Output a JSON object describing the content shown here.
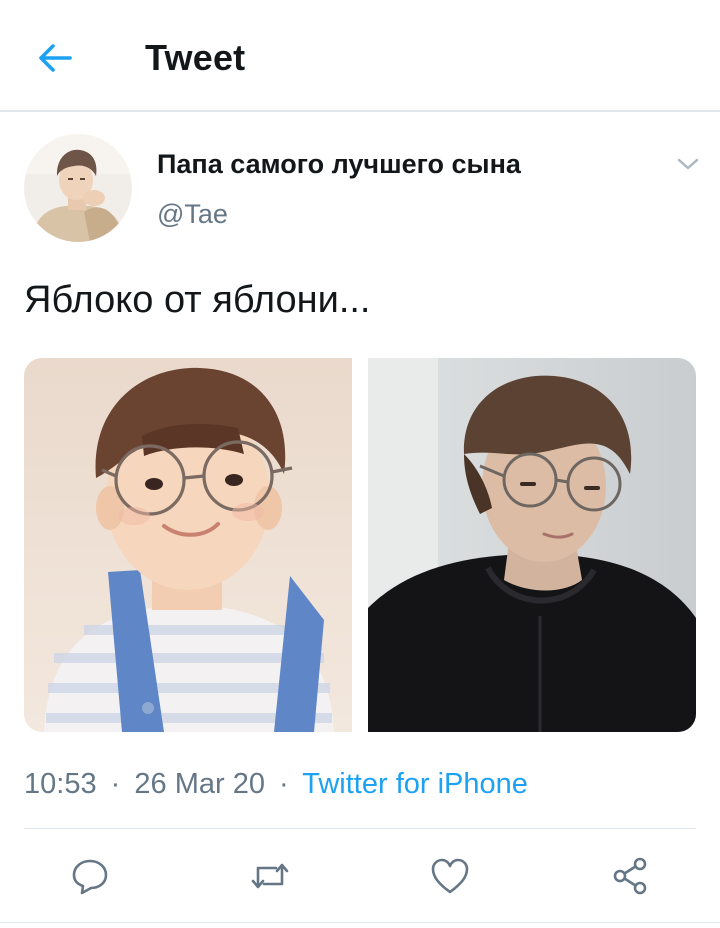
{
  "header": {
    "title": "Tweet",
    "back_icon": "back-arrow-icon"
  },
  "tweet": {
    "display_name": "Папа самого лучшего сына",
    "handle": "@Tae",
    "text": "Яблоко от яблони...",
    "time": "10:53",
    "date": "26 Mar 20",
    "separator": "·",
    "source": "Twitter for iPhone",
    "menu_icon": "chevron-down-icon"
  },
  "media": {
    "photos": [
      {
        "description_icon": "photo-child-with-glasses"
      },
      {
        "description_icon": "photo-young-man-with-glasses"
      }
    ]
  },
  "actions": {
    "icons": [
      "reply-icon",
      "retweet-icon",
      "like-icon",
      "share-icon"
    ]
  },
  "colors": {
    "accent": "#1da1f2",
    "text": "#14171a",
    "secondary": "#657786",
    "border": "#e1e8ed"
  }
}
